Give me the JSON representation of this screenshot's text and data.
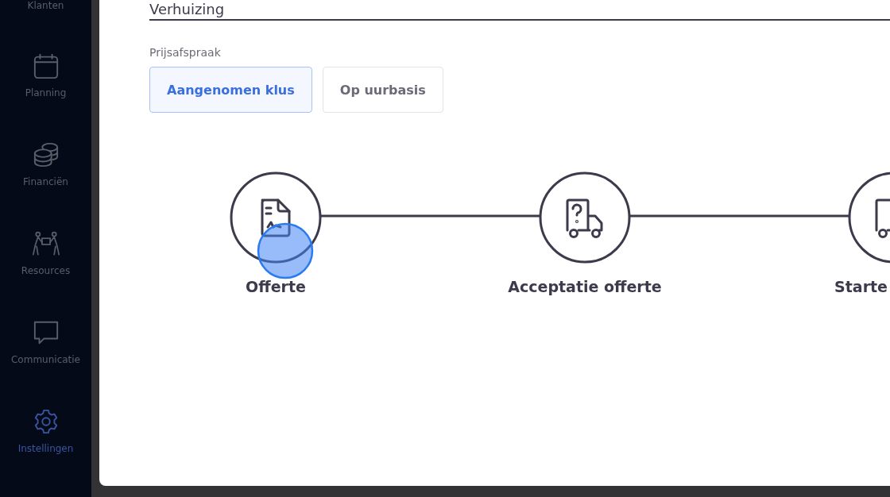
{
  "sidebar": {
    "items": [
      {
        "label": "Klanten",
        "kind": "cut",
        "selected": false
      },
      {
        "label": "Planning",
        "kind": "calendar",
        "selected": false
      },
      {
        "label": "Financiën",
        "kind": "coins",
        "selected": false
      },
      {
        "label": "Resources",
        "kind": "people",
        "selected": false
      },
      {
        "label": "Communicatie",
        "kind": "chat",
        "selected": false
      },
      {
        "label": "Instellingen",
        "kind": "gear",
        "selected": true
      }
    ]
  },
  "job_field": {
    "value": "Verhuizing"
  },
  "pricing": {
    "label": "Prijsafspraak",
    "options": [
      {
        "label": "Aangenomen klus",
        "selected": true
      },
      {
        "label": "Op uurbasis",
        "selected": false
      }
    ]
  },
  "steps": [
    {
      "label": "Offerte",
      "kind": "document"
    },
    {
      "label": "Acceptatie offerte",
      "kind": "question-truck"
    },
    {
      "label": "Starte",
      "kind": "truck"
    }
  ]
}
